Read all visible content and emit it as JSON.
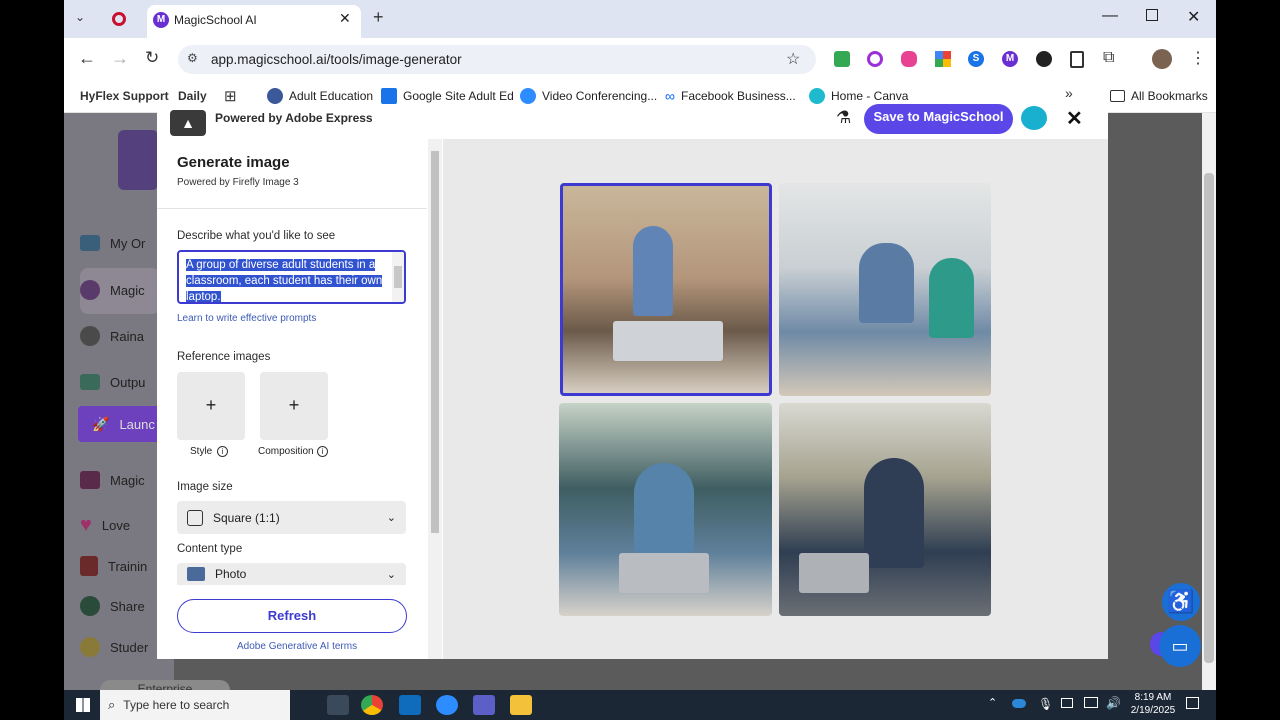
{
  "browser": {
    "tab_title": "MagicSchool AI",
    "url": "app.magicschool.ai/tools/image-generator",
    "bookmarks": [
      "HyFlex Support",
      "Daily",
      "Adult Education",
      "Google Site Adult Ed",
      "Video Conferencing...",
      "Facebook Business...",
      "Home - Canva"
    ],
    "all_bookmarks": "All Bookmarks"
  },
  "sidebar": {
    "items": [
      "My Or",
      "Magic",
      "Raina",
      "Outpu",
      "Launc",
      "Magic",
      "Love",
      "Trainin",
      "Share",
      "Studer"
    ],
    "footer": "Enterprise"
  },
  "modal": {
    "powered_by_express": "Powered by Adobe Express",
    "save_button": "Save to MagicSchool",
    "title": "Generate image",
    "subtitle": "Powered by Firefly Image 3",
    "prompt_label": "Describe what you'd like to see",
    "prompt_value": "A group of diverse adult students in a classroom, each student has their own laptop.",
    "learn_link": "Learn to write effective prompts",
    "reference_label": "Reference images",
    "style_label": "Style",
    "composition_label": "Composition",
    "image_size_label": "Image size",
    "image_size_value": "Square (1:1)",
    "content_type_label": "Content type",
    "content_type_value": "Photo",
    "refresh_button": "Refresh",
    "terms_link": "Adobe Generative AI terms"
  },
  "colors": {
    "accent": "#5b46e8",
    "selected_border": "#3d3ad1",
    "sidebar_active": "#6a2fd3",
    "link": "#3d5bb5"
  },
  "taskbar": {
    "search_placeholder": "Type here to search",
    "time": "8:19 AM",
    "date": "2/19/2025"
  }
}
